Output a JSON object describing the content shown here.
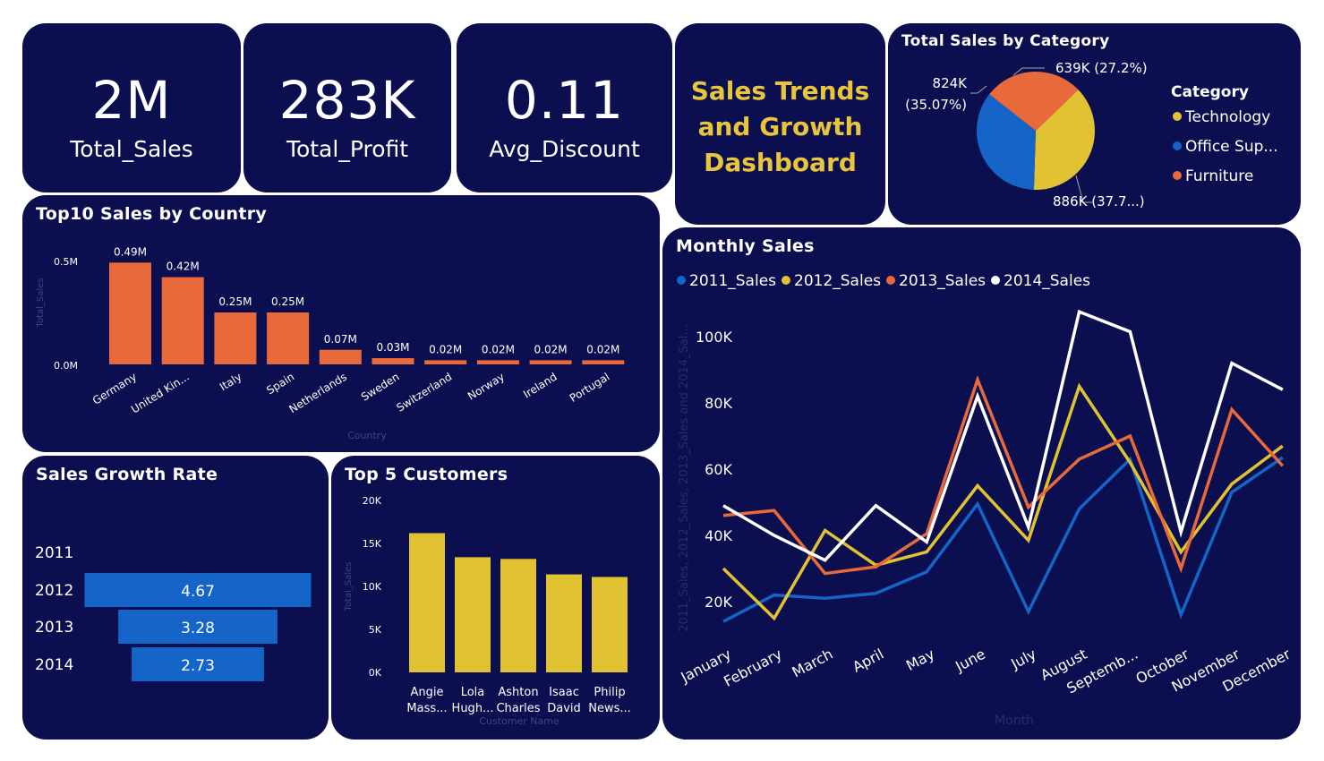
{
  "kpis": [
    {
      "value": "2M",
      "label": "Total_Sales"
    },
    {
      "value": "283K",
      "label": "Total_Profit"
    },
    {
      "value": "0.11",
      "label": "Avg_Discount"
    }
  ],
  "dashboard_title": {
    "line1": "Sales Trends",
    "line2": "and Growth",
    "line3": "Dashboard"
  },
  "colors": {
    "background": "#0b0f4f",
    "orange": "#e8693a",
    "yellow": "#e1c233",
    "blue": "#1565c8",
    "white": "#ffffff",
    "title": "#e8c53a"
  },
  "chart_data": [
    {
      "id": "category_pie",
      "type": "pie",
      "title": "Total Sales by Category",
      "legend_title": "Category",
      "legend_position": "right",
      "legend": [
        "Technology",
        "Office Sup...",
        "Furniture"
      ],
      "slices": [
        {
          "name": "Technology",
          "value": 886,
          "label": "886K (37.7...)",
          "color": "#e1c233"
        },
        {
          "name": "Office Supplies",
          "value": 824,
          "label_line1": "824K",
          "label_line2": "(35.07%)",
          "color": "#1565c8"
        },
        {
          "name": "Furniture",
          "value": 639,
          "label": "639K (27.2%)",
          "color": "#e8693a"
        }
      ]
    },
    {
      "id": "country_bar",
      "type": "bar",
      "title": "Top10 Sales by Country",
      "xlabel": "Country",
      "ylabel": "Total_Sales",
      "ylim": [
        0,
        0.5
      ],
      "yticks": [
        "0.0M",
        "0.5M"
      ],
      "categories": [
        "Germany",
        "United Kin...",
        "Italy",
        "Spain",
        "Netherlands",
        "Sweden",
        "Switzerland",
        "Norway",
        "Ireland",
        "Portugal"
      ],
      "values": [
        0.49,
        0.42,
        0.25,
        0.25,
        0.07,
        0.03,
        0.02,
        0.02,
        0.02,
        0.02
      ],
      "data_labels": [
        "0.49M",
        "0.42M",
        "0.25M",
        "0.25M",
        "0.07M",
        "0.03M",
        "0.02M",
        "0.02M",
        "0.02M",
        "0.02M"
      ]
    },
    {
      "id": "growth_funnel",
      "type": "bar",
      "orientation": "horizontal-funnel",
      "title": "Sales Growth Rate",
      "categories": [
        "2011",
        "2012",
        "2013",
        "2014"
      ],
      "values": [
        0,
        4.67,
        3.28,
        2.73
      ],
      "data_labels": [
        "",
        "4.67",
        "3.28",
        "2.73"
      ]
    },
    {
      "id": "customers_bar",
      "type": "bar",
      "title": "Top 5 Customers",
      "xlabel": "Customer Name",
      "ylabel": "Total_Sales",
      "ylim": [
        0,
        20000
      ],
      "yticks": [
        "0K",
        "5K",
        "10K",
        "15K",
        "20K"
      ],
      "categories": [
        [
          "Angie",
          "Mass..."
        ],
        [
          "Lola",
          "Hugh..."
        ],
        [
          "Ashton",
          "Charles"
        ],
        [
          "Isaac",
          "David"
        ],
        [
          "Philip",
          "News..."
        ]
      ],
      "values": [
        16200,
        13400,
        13200,
        11400,
        11100
      ]
    },
    {
      "id": "monthly_line",
      "type": "line",
      "title": "Monthly Sales",
      "xlabel": "Month",
      "ylabel": "2011_Sales, 2012_Sales, 2013_Sales and 2014_Sal...",
      "legend_position": "top-left",
      "ylim": [
        10000,
        110000
      ],
      "yticks": [
        "20K",
        "40K",
        "60K",
        "80K",
        "100K"
      ],
      "categories": [
        "January",
        "February",
        "March",
        "April",
        "May",
        "June",
        "July",
        "August",
        "Septemb...",
        "October",
        "November",
        "December"
      ],
      "series": [
        {
          "name": "2011_Sales",
          "color": "#1565c8",
          "values": [
            14000,
            22000,
            21000,
            22500,
            29000,
            49500,
            17000,
            48000,
            63000,
            16000,
            53000,
            63500
          ]
        },
        {
          "name": "2012_Sales",
          "color": "#e1c233",
          "values": [
            30000,
            15000,
            41500,
            31000,
            35000,
            55000,
            38500,
            85000,
            62000,
            35000,
            55500,
            67000
          ]
        },
        {
          "name": "2013_Sales",
          "color": "#e8693a",
          "values": [
            46000,
            47500,
            28500,
            30500,
            40500,
            87000,
            48500,
            63000,
            70000,
            30000,
            78000,
            61000
          ]
        },
        {
          "name": "2014_Sales",
          "color": "#ffffff",
          "values": [
            49000,
            40000,
            32500,
            49000,
            38000,
            82000,
            42500,
            107500,
            101500,
            41000,
            92000,
            84000
          ]
        }
      ]
    }
  ]
}
